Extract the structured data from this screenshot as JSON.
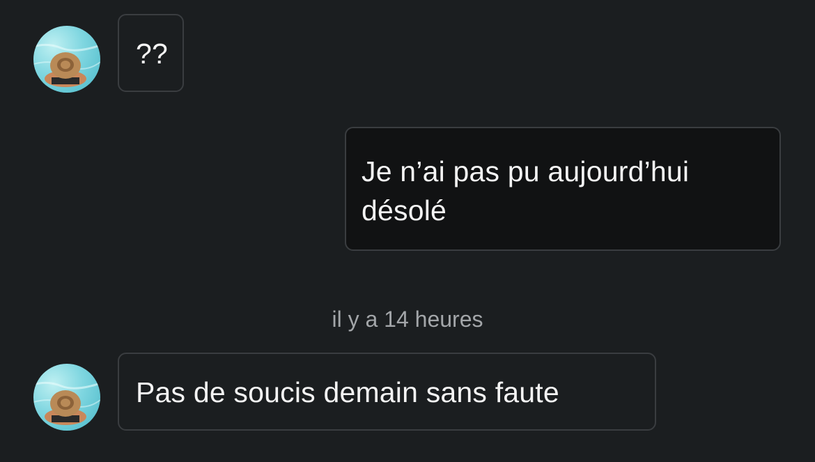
{
  "messages": [
    {
      "sender": "other",
      "text": "??"
    },
    {
      "sender": "me",
      "text": "Je n’ai pas pu aujourd’hui désolé"
    },
    {
      "sender": "other",
      "text": "Pas de soucis demain sans faute"
    }
  ],
  "timestamp": "il y a 14 heures",
  "colors": {
    "background": "#1b1e20",
    "bubble_border": "#3a3d40",
    "outgoing_bubble": "#111213",
    "text": "#f4f4f4",
    "timestamp_text": "#a3a6a9"
  }
}
